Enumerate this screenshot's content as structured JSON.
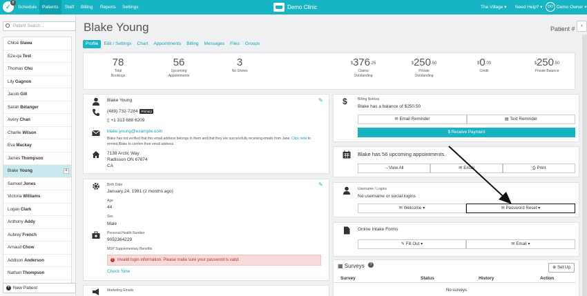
{
  "nav": {
    "badge": "8",
    "items": [
      "Schedule",
      "Patients",
      "Staff",
      "Billing",
      "Reports",
      "Settings"
    ],
    "clinic": "Demo Clinic",
    "location": "The Village",
    "help": "Need Help?",
    "avatar_initials": "DO",
    "user": "Demo Owner"
  },
  "sidebar": {
    "search_placeholder": "Patient Search...",
    "patients": [
      {
        "first": "Chloe",
        "last": "Slawa"
      },
      {
        "first": "E2e-qa",
        "last": "Test"
      },
      {
        "first": "Thomas",
        "last": "Chu"
      },
      {
        "first": "Lily",
        "last": "Gagnon"
      },
      {
        "first": "Jacob",
        "last": "Gill"
      },
      {
        "first": "Sarah",
        "last": "Bélanger"
      },
      {
        "first": "Avery",
        "last": "Chan"
      },
      {
        "first": "Charlie",
        "last": "Wilson"
      },
      {
        "first": "Eva",
        "last": "Mackay"
      },
      {
        "first": "James",
        "last": "Thompson"
      },
      {
        "first": "Blake",
        "last": "Young"
      },
      {
        "first": "Samuel",
        "last": "Jones"
      },
      {
        "first": "Victoria",
        "last": "Williams"
      },
      {
        "first": "Logan",
        "last": "Clark"
      },
      {
        "first": "Anthony",
        "last": "Addy"
      },
      {
        "first": "Aubrey",
        "last": "French"
      },
      {
        "first": "Arnaud",
        "last": "Chow"
      },
      {
        "first": "Addison",
        "last": "Anderson"
      },
      {
        "first": "Nathan",
        "last": "Thompson"
      }
    ],
    "new_patient": "New Patient"
  },
  "header": {
    "name": "Blake Young",
    "patient_num": "Patient #",
    "tabs": [
      "Profile",
      "Edit / Settings",
      "Chart",
      "Appointments",
      "Billing",
      "Messages",
      "Files",
      "Groups"
    ]
  },
  "stats": {
    "total_bookings": {
      "value": "78",
      "label1": "Total",
      "label2": "Bookings"
    },
    "upcoming": {
      "value": "56",
      "label1": "Upcoming",
      "label2": "Appointments"
    },
    "no_shows": {
      "value": "3",
      "label1": "No Shows"
    },
    "claims": {
      "dollars": "376",
      "cents": "25",
      "label1": "Claims",
      "label2": "Outstanding"
    },
    "private": {
      "dollars": "250",
      "cents": "50",
      "label1": "Private",
      "label2": "Outstanding"
    },
    "credit": {
      "dollars": "0",
      "cents": "00",
      "label1": "Credit"
    },
    "private_balance": {
      "dollars": "250",
      "cents": "50",
      "label1": "Private Balance"
    }
  },
  "contact": {
    "name": "Blake Young",
    "phone1": "(489) 732-7284",
    "phone1_tag": "Primary",
    "phone2": "+1 313 688 6209",
    "email": "blake.young@example.com",
    "email_note1": "Blake has not verified that this email address belongs to them and that they are successfully receiving emails from Jane.",
    "email_note_link": "Click here",
    "email_note2": "to remind Blake to confirm their email address.",
    "address1": "7138 Arctic Way",
    "address2": "Radisson ON 67874",
    "address3": "CA"
  },
  "details": {
    "birth_label": "Birth Date",
    "birth": "January 24, 1981 (2 months ago)",
    "age_label": "Age",
    "age": "44",
    "sex_label": "Sex",
    "sex": "Male",
    "phn_label": "Personal Health Number",
    "phn": "9052364229",
    "msp_label": "MSP Supplementary Benefits",
    "alert": "Invalid login information. Please make sure your password is valid.",
    "check_now": "Check Now"
  },
  "marketing": {
    "label": "Marketing Emails"
  },
  "billing_notices": {
    "label": "Billing Notices",
    "text": "Blake has a balance of $250.50",
    "email_reminder": "Email Reminder",
    "text_reminder": "Text Reminder",
    "receive_payment": "Receive Payment"
  },
  "appointments": {
    "text": "Blake has 56 upcoming appointments.",
    "view_all": "View All",
    "email": "Email",
    "print": "Print"
  },
  "logins": {
    "label": "Username / Logins",
    "text": "No username or social logins",
    "welcome": "Welcome",
    "password_reset": "Password Reset"
  },
  "intake": {
    "title": "Online Intake Forms",
    "fill_out": "Fill Out",
    "email": "Email"
  },
  "surveys": {
    "title": "Surveys",
    "set_up": "Set Up",
    "columns": [
      "Survey",
      "Status",
      "History",
      "Action"
    ],
    "empty": "No surveys"
  },
  "colors": {
    "accent": "#17b5c4",
    "highlight_border": "#111111"
  }
}
